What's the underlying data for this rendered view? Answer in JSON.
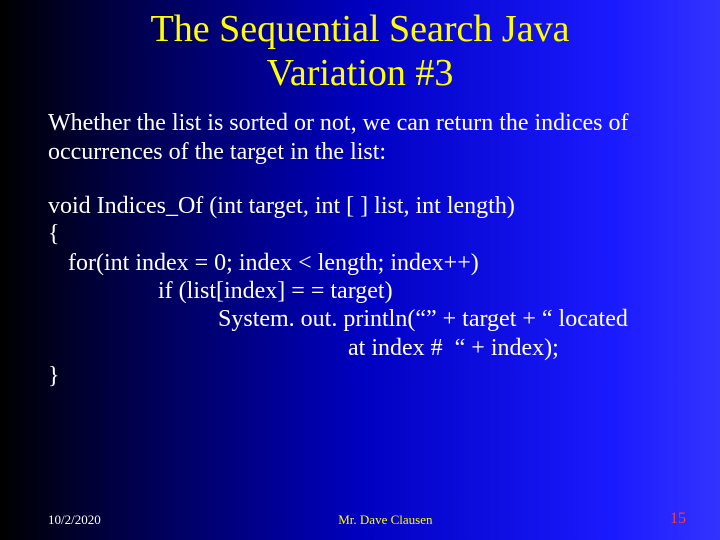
{
  "title_line1": "The Sequential Search Java",
  "title_line2": "Variation #3",
  "intro": "Whether  the list is sorted or not, we can return the indices of occurrences of the target in the list:",
  "code": {
    "l1": "void Indices_Of (int target, int [ ] list, int length)",
    "l2": "{",
    "l3": "for(int index = 0; index < length; index++)",
    "l4": "if (list[index] = = target)",
    "l5": "System. out. println(“” + target + “ located",
    "l6": "at index #  “ + index);",
    "l7": "}"
  },
  "footer": {
    "date": "10/2/2020",
    "author": "Mr. Dave Clausen",
    "page": "15"
  }
}
